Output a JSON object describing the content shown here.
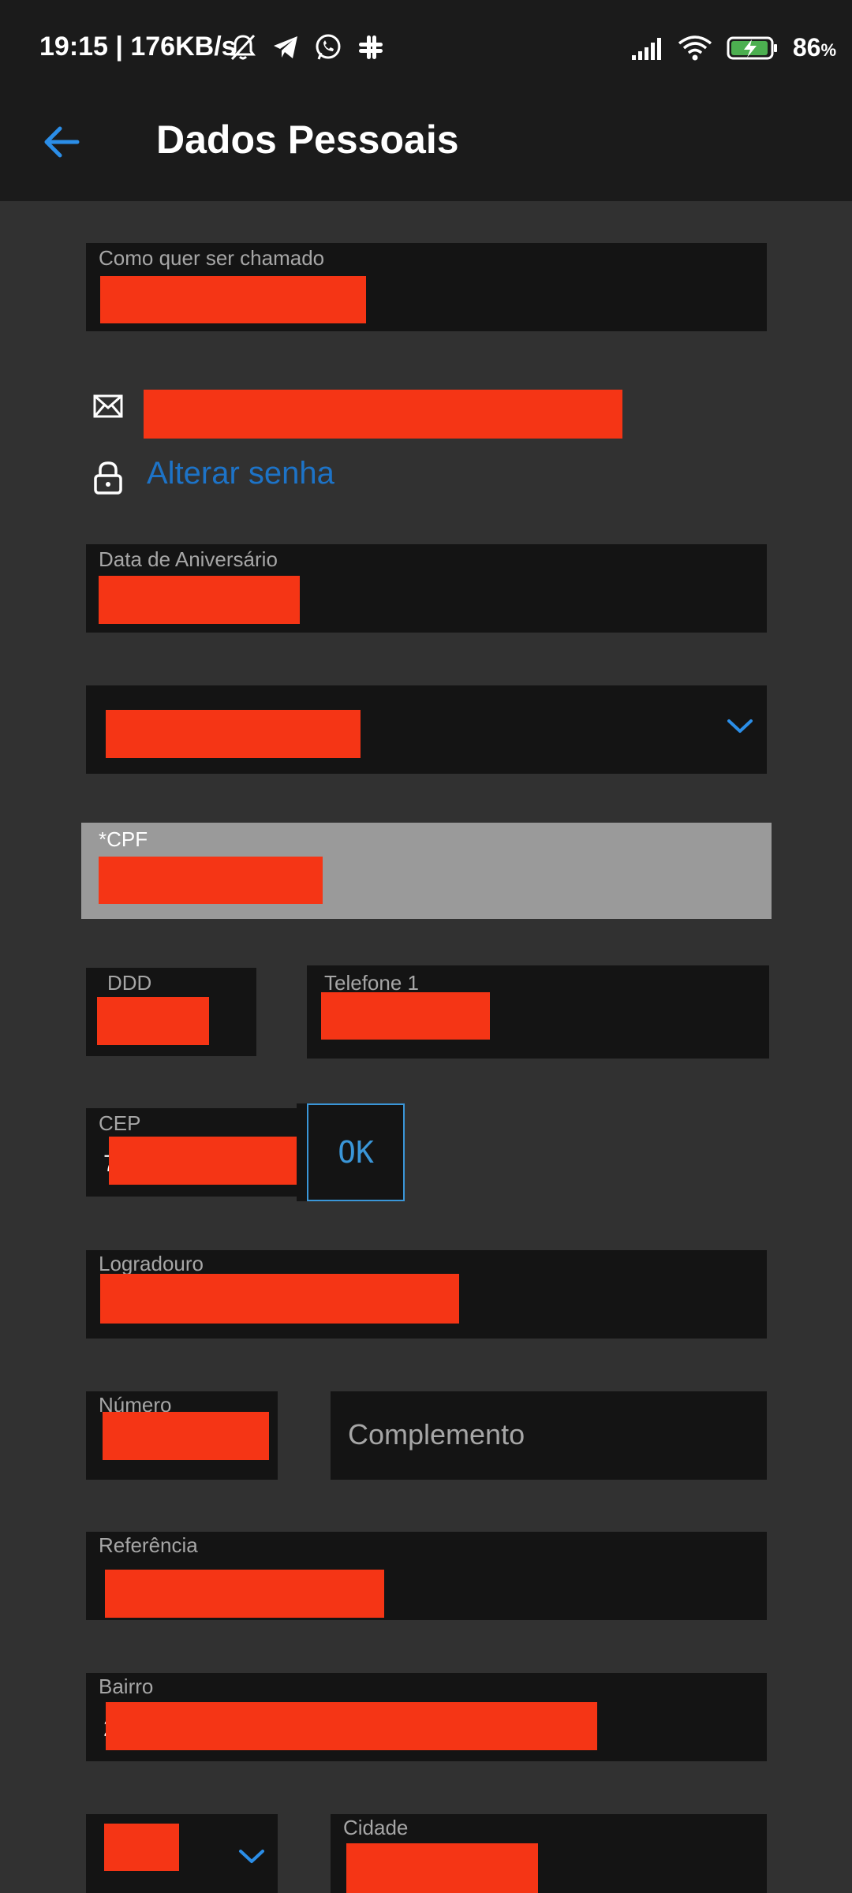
{
  "status_bar": {
    "time_speed": "19:15 | 176KB/s",
    "battery_pct": "86",
    "battery_unit": "%"
  },
  "header": {
    "title": "Dados Pessoais"
  },
  "form": {
    "nickname_label": "Como quer ser chamado",
    "change_password_label": "Alterar senha",
    "birthday_label": "Data de Aniversário",
    "cpf_label": "*CPF",
    "ddd_label": "DDD",
    "phone1_label": "Telefone 1",
    "cep_label": "CEP",
    "cep_stray_char": "7",
    "ok_label": "OK",
    "street_label": "Logradouro",
    "number_label": "Número",
    "complement_placeholder": "Complemento",
    "reference_label": "Referência",
    "district_label": "Bairro",
    "district_stray_char": "2",
    "city_label": "Cidade"
  },
  "colors": {
    "accent": "#1d73c7",
    "redaction": "#f53515",
    "background": "#313131",
    "field": "#141414"
  },
  "icons": [
    "back-arrow-icon",
    "mail-icon",
    "lock-icon",
    "chevron-down-icon"
  ]
}
